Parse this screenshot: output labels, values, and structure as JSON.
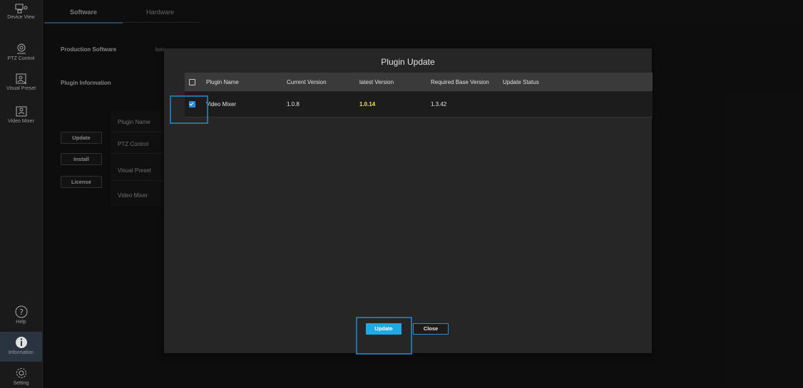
{
  "sidebar": {
    "items": [
      {
        "label": "Device View",
        "icon": "device-view-icon"
      },
      {
        "label": "PTZ Control",
        "icon": "ptz-camera-icon"
      },
      {
        "label": "Visual Preset",
        "icon": "visual-preset-icon"
      },
      {
        "label": "Video Mixer",
        "icon": "video-mixer-icon"
      },
      {
        "label": "Help",
        "icon": "help-icon"
      },
      {
        "label": "Information",
        "icon": "info-icon"
      },
      {
        "label": "Setting",
        "icon": "gear-icon"
      }
    ]
  },
  "tabs": {
    "software": "Software",
    "hardware": "Hardware"
  },
  "background": {
    "production_software_label": "Production Software",
    "production_software_value": "bas...",
    "plugin_info_label": "Plugin Information",
    "buttons": {
      "update": "Update",
      "install": "Install",
      "license": "License"
    },
    "table_header": "Plugin Name",
    "table_rows": [
      "PTZ Control",
      "Visual Preset",
      "Video Mixer"
    ]
  },
  "dialog": {
    "title": "Plugin Update",
    "columns": [
      "Plugin Name",
      "Current Version",
      "latest Version",
      "Required Base Version",
      "Update Status"
    ],
    "rows": [
      {
        "checked": true,
        "plugin_name": "Video Mixer",
        "current_version": "1.0.8",
        "latest_version": "1.0.14",
        "required_base_version": "1.3.42",
        "update_status": ""
      }
    ],
    "update_label": "Update",
    "close_label": "Close"
  },
  "colors": {
    "accent": "#21a9e6",
    "highlight_version": "#f2e13a",
    "callout_border": "#1f73a6"
  }
}
